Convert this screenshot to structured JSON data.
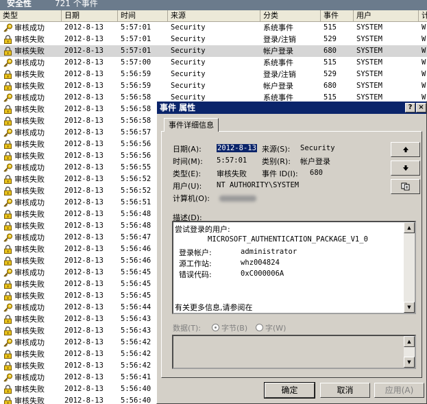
{
  "window": {
    "title": "安全性",
    "event_count": "721 个事件"
  },
  "columns": [
    "类型",
    "日期",
    "时间",
    "来源",
    "分类",
    "事件",
    "用户",
    "计"
  ],
  "icons": {
    "success": "key-icon",
    "failure": "lock-icon"
  },
  "rows": [
    {
      "type": "审核成功",
      "kind": "success",
      "date": "2012-8-13",
      "time": "5:57:01",
      "source": "Security",
      "category": "系统事件",
      "event": "515",
      "user": "SYSTEM",
      "c": "W"
    },
    {
      "type": "审核失败",
      "kind": "failure",
      "date": "2012-8-13",
      "time": "5:57:01",
      "source": "Security",
      "category": "登录/注销",
      "event": "529",
      "user": "SYSTEM",
      "c": "W"
    },
    {
      "type": "审核失败",
      "kind": "failure",
      "date": "2012-8-13",
      "time": "5:57:01",
      "source": "Security",
      "category": "帐户登录",
      "event": "680",
      "user": "SYSTEM",
      "c": "W",
      "selected": true
    },
    {
      "type": "审核成功",
      "kind": "success",
      "date": "2012-8-13",
      "time": "5:57:00",
      "source": "Security",
      "category": "系统事件",
      "event": "515",
      "user": "SYSTEM",
      "c": "W"
    },
    {
      "type": "审核失败",
      "kind": "failure",
      "date": "2012-8-13",
      "time": "5:56:59",
      "source": "Security",
      "category": "登录/注销",
      "event": "529",
      "user": "SYSTEM",
      "c": "W"
    },
    {
      "type": "审核失败",
      "kind": "failure",
      "date": "2012-8-13",
      "time": "5:56:59",
      "source": "Security",
      "category": "帐户登录",
      "event": "680",
      "user": "SYSTEM",
      "c": "W"
    },
    {
      "type": "审核成功",
      "kind": "success",
      "date": "2012-8-13",
      "time": "5:56:58",
      "source": "Security",
      "category": "系统事件",
      "event": "515",
      "user": "SYSTEM",
      "c": "W"
    },
    {
      "type": "审核失败",
      "kind": "failure",
      "date": "2012-8-13",
      "time": "5:56:58"
    },
    {
      "type": "审核失败",
      "kind": "failure",
      "date": "2012-8-13",
      "time": "5:56:58"
    },
    {
      "type": "审核成功",
      "kind": "success",
      "date": "2012-8-13",
      "time": "5:56:57"
    },
    {
      "type": "审核失败",
      "kind": "failure",
      "date": "2012-8-13",
      "time": "5:56:56"
    },
    {
      "type": "审核失败",
      "kind": "failure",
      "date": "2012-8-13",
      "time": "5:56:56"
    },
    {
      "type": "审核成功",
      "kind": "success",
      "date": "2012-8-13",
      "time": "5:56:55"
    },
    {
      "type": "审核失败",
      "kind": "failure",
      "date": "2012-8-13",
      "time": "5:56:52"
    },
    {
      "type": "审核失败",
      "kind": "failure",
      "date": "2012-8-13",
      "time": "5:56:52"
    },
    {
      "type": "审核成功",
      "kind": "success",
      "date": "2012-8-13",
      "time": "5:56:51"
    },
    {
      "type": "审核失败",
      "kind": "failure",
      "date": "2012-8-13",
      "time": "5:56:48"
    },
    {
      "type": "审核失败",
      "kind": "failure",
      "date": "2012-8-13",
      "time": "5:56:48"
    },
    {
      "type": "审核成功",
      "kind": "success",
      "date": "2012-8-13",
      "time": "5:56:47"
    },
    {
      "type": "审核失败",
      "kind": "failure",
      "date": "2012-8-13",
      "time": "5:56:46"
    },
    {
      "type": "审核失败",
      "kind": "failure",
      "date": "2012-8-13",
      "time": "5:56:46"
    },
    {
      "type": "审核成功",
      "kind": "success",
      "date": "2012-8-13",
      "time": "5:56:45"
    },
    {
      "type": "审核失败",
      "kind": "failure",
      "date": "2012-8-13",
      "time": "5:56:45"
    },
    {
      "type": "审核失败",
      "kind": "failure",
      "date": "2012-8-13",
      "time": "5:56:45"
    },
    {
      "type": "审核成功",
      "kind": "success",
      "date": "2012-8-13",
      "time": "5:56:44"
    },
    {
      "type": "审核失败",
      "kind": "failure",
      "date": "2012-8-13",
      "time": "5:56:43"
    },
    {
      "type": "审核失败",
      "kind": "failure",
      "date": "2012-8-13",
      "time": "5:56:43"
    },
    {
      "type": "审核成功",
      "kind": "success",
      "date": "2012-8-13",
      "time": "5:56:42"
    },
    {
      "type": "审核失败",
      "kind": "failure",
      "date": "2012-8-13",
      "time": "5:56:42"
    },
    {
      "type": "审核失败",
      "kind": "failure",
      "date": "2012-8-13",
      "time": "5:56:42"
    },
    {
      "type": "审核成功",
      "kind": "success",
      "date": "2012-8-13",
      "time": "5:56:41"
    },
    {
      "type": "审核失败",
      "kind": "failure",
      "date": "2012-8-13",
      "time": "5:56:40"
    },
    {
      "type": "审核失败",
      "kind": "failure",
      "date": "2012-8-13",
      "time": "5:56:40"
    }
  ],
  "dialog": {
    "title": "事件 属性",
    "help": "?",
    "close": "×",
    "tab": "事件详细信息",
    "date_label": "日期(A):",
    "date_value": "2012-8-13",
    "source_label": "来源(S):",
    "source_value": "Security",
    "time_label": "时间(M):",
    "time_value": "5:57:01",
    "category_label": "类别(R):",
    "category_value": "帐户登录",
    "type_label": "类型(E):",
    "type_value": "审核失败",
    "eventid_label": "事件 ID(I):",
    "eventid_value": "680",
    "user_label": "用户(U):",
    "user_value": "NT AUTHORITY\\SYSTEM",
    "computer_label": "计算机(O):",
    "desc_label": "描述(D):",
    "desc_lines": [
      "尝试登录的用户:",
      "MICROSOFT_AUTHENTICATION_PACKAGE_V1_0",
      "登录帐户:",
      "administrator",
      "源工作站:",
      "whz004824",
      "错误代码:",
      "0xC000006A",
      "有关更多信息,请参阅在"
    ],
    "data_label": "数据(T):",
    "radio_bytes": "字节(B)",
    "radio_words": "字(W)",
    "ok": "确定",
    "cancel": "取消",
    "apply": "应用(A)"
  }
}
